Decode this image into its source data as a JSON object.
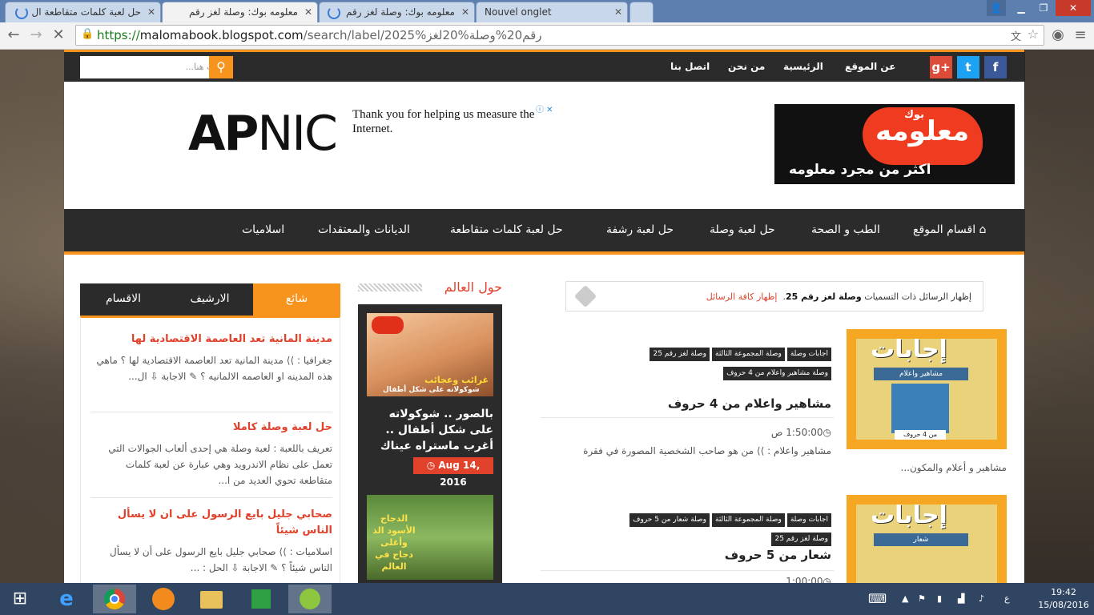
{
  "browser": {
    "tabs": [
      {
        "title": "حل لعبة كلمات متقاطعة ال"
      },
      {
        "title": "معلومه بوك: وصلة لغز رقم"
      },
      {
        "title": "معلومه بوك: وصلة لغز رقم"
      },
      {
        "title": "Nouvel onglet"
      }
    ],
    "url_scheme": "https://",
    "url_host": "malomabook.blogspot.com",
    "url_path": "/search/label/2025%رقم20%وصلة%20لغز"
  },
  "site": {
    "search_placeholder": "ابحث هنا...",
    "top_links": {
      "about": "عن الموقع",
      "home": "الرئيسية",
      "who": "من نحن",
      "contact": "اتصل بنا"
    },
    "social": {
      "facebook": "f",
      "twitter": "t",
      "gplus": "g+"
    },
    "ad": {
      "brand_a": "AP",
      "brand_b": "NIC",
      "text": "Thank you for helping us measure the Internet."
    },
    "logo": {
      "main": "معلومه",
      "sub": "اكثر من مجرد معلومه",
      "small": "بوك"
    },
    "nav": {
      "sections": "اقسام الموقع",
      "health": "الطب و الصحة",
      "wasla": "حل لعبة وصلة",
      "rashfa": "حل لعبة رشفة",
      "crossword": "حل لعبة كلمات متقاطعة",
      "religions": "الديانات والمعتقدات",
      "islamic": "اسلاميات"
    }
  },
  "sidebar": {
    "tabs": [
      "شائع",
      "الارشيف",
      "الاقسام"
    ],
    "posts": [
      {
        "title": "مدينة المانية تعد العاصمة الاقتصادية لها",
        "body": "جغرافيا : ⟩⟩ مدينة المانية تعد العاصمة الاقتصادية لها ؟ ماهي هذه المدينه او العاصمه الالمانيه ؟ ✎ الاجابة ⇩ ال..."
      },
      {
        "title": "حل لعبة وصلة كاملا",
        "body": "تعريف باللعبة : لعبة وصلة هي إحدى ألعاب الجوالات التي تعمل على نظام الاندرويد وهي عبارة عن لعبة كلمات متقاطعة تحوي العديد من ا..."
      },
      {
        "title": "صحابي جليل بايع الرسول على ان لا يسأل الناس شيئاً",
        "body": "اسلاميات : ⟩⟩ صحابي جليل بايع الرسول على أن لا يسأل الناس شيئاً ؟ ✎ الاجابة ⇩ الحل : ..."
      }
    ]
  },
  "middle": {
    "heading": "حول العالم",
    "post1": {
      "title": "بالصور .. شوكولاته على شكل أطفال .. أغرب ماستراه عيناك",
      "date": "Aug 14, 2016",
      "img_caption": "غرائب وعجائب",
      "img_sub": "شوكولاته على شكل أطفال"
    },
    "post2": {
      "img_caption": "الدجاج الأسود الذ وأغلى دجاج في العالم"
    }
  },
  "main": {
    "label_notice": {
      "prefix": "إظهار الرسائل ذات التسميات",
      "label": "وصلة لغز رقم 25",
      "show_all": "إظهار كافة الرسائل"
    },
    "posts": [
      {
        "tags": [
          "اجابات وصلة",
          "وصلة المجموعة الثالثة",
          "وصلة لغز رقم 25",
          "وصلة مشاهير واعلام من 4 حروف"
        ],
        "title": "مشاهير واعلام من 4 حروف",
        "time": "1:50:00 ص",
        "excerpt": "مشاهير واعلام : ⟩⟩ من هو صاحب الشخصية المصورة في فقرة",
        "more": "مشاهير و أعلام والمكون...",
        "img_big": "إجابات",
        "img_band": "مشاهير واعلام",
        "img_foot": "من 4 حروف"
      },
      {
        "tags": [
          "اجابات وصلة",
          "وصلة المجموعة الثالثة",
          "وصلة شعار من 5 حروف",
          "وصلة لغز رقم 25"
        ],
        "title": "شعار من 5 حروف",
        "time": "1:00:00",
        "img_big": "إجابات",
        "img_band": "شعار"
      }
    ]
  },
  "taskbar": {
    "time": "19:42",
    "date": "15/08/2016",
    "lang": "ع"
  }
}
